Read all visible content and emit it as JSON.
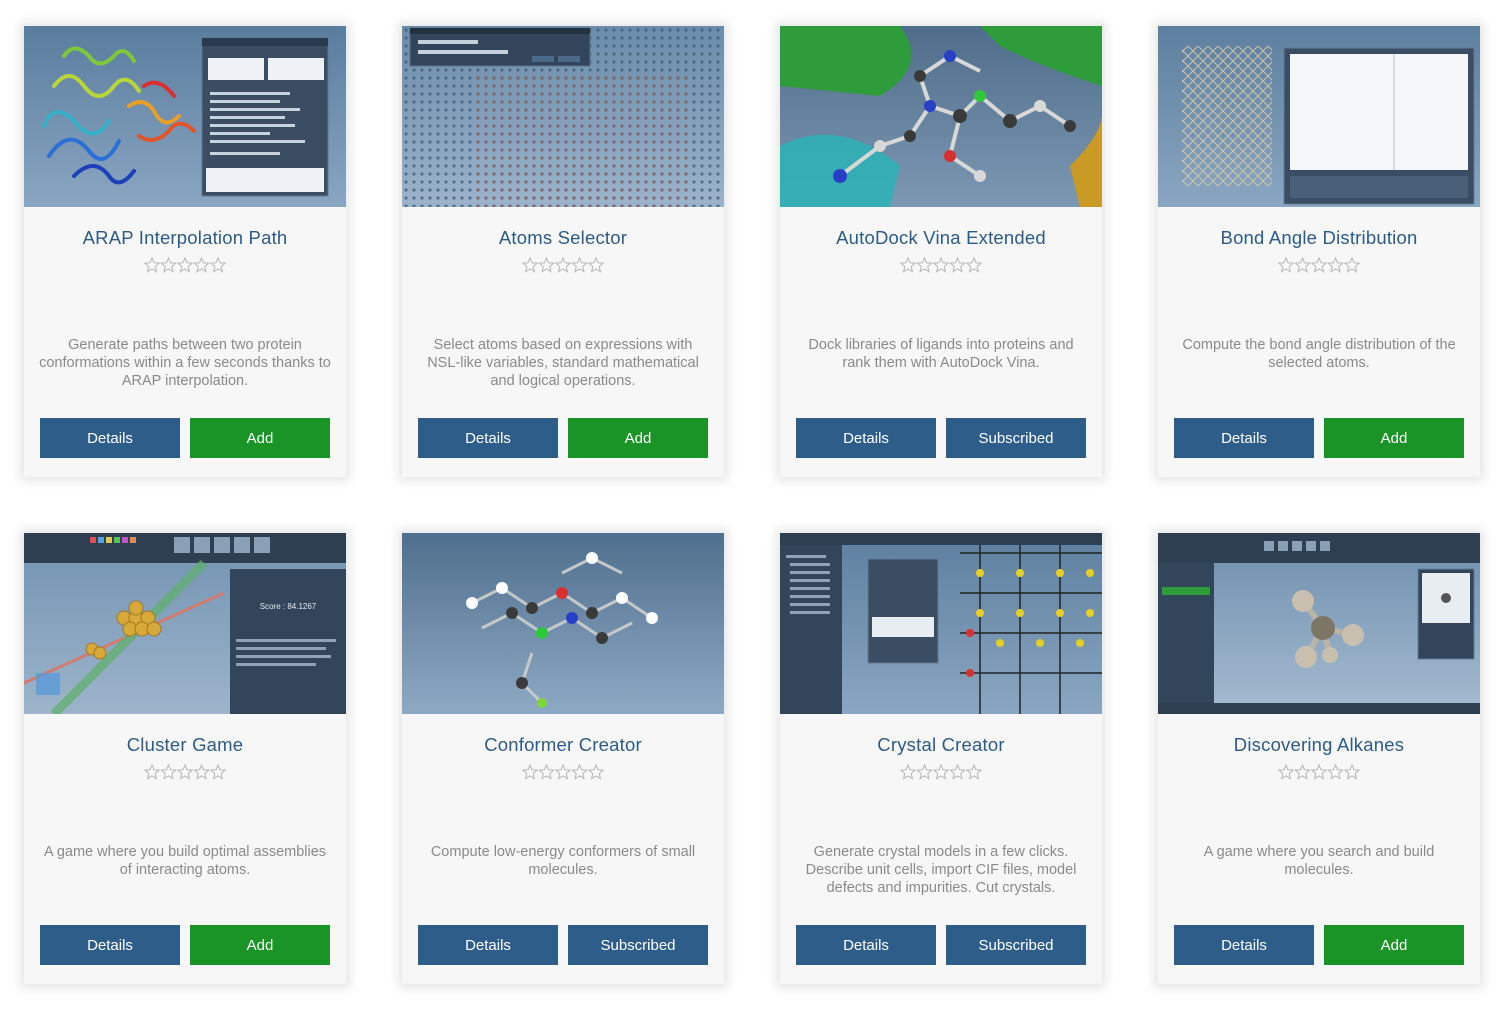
{
  "colors": {
    "title": "#2e5b86",
    "description": "#8a8a8a",
    "details_button": "#2f5d89",
    "add_button": "#1a9426",
    "subscribed_button": "#2f5d89",
    "card_background": "#f7f7f7"
  },
  "rating_max": 5,
  "cards": [
    {
      "title": "ARAP Interpolation Path",
      "rating": 0,
      "description": "Generate paths between two protein conformations within a few seconds thanks to ARAP interpolation.",
      "details_label": "Details",
      "action_label": "Add",
      "action_state": "add",
      "thumbnail": "protein-ribbon-with-dialog"
    },
    {
      "title": "Atoms Selector",
      "rating": 0,
      "description": "Select atoms based on expressions with NSL-like variables, standard mathematical and logical operations.",
      "details_label": "Details",
      "action_label": "Add",
      "action_state": "add",
      "thumbnail": "atom-lattice-with-dialog"
    },
    {
      "title": "AutoDock Vina Extended",
      "rating": 0,
      "description": "Dock libraries of ligands into proteins and rank them with AutoDock Vina.",
      "details_label": "Details",
      "action_label": "Subscribed",
      "action_state": "subscribed",
      "thumbnail": "ligand-in-protein"
    },
    {
      "title": "Bond Angle Distribution",
      "rating": 0,
      "description": "Compute the bond angle distribution of the selected atoms.",
      "details_label": "Details",
      "action_label": "Add",
      "action_state": "add",
      "thumbnail": "crystal-with-plot-window"
    },
    {
      "title": "Cluster Game",
      "rating": 0,
      "description": "A game where you build optimal assemblies of interacting atoms.",
      "details_label": "Details",
      "action_label": "Add",
      "action_state": "add",
      "thumbnail": "cluster-game-screen",
      "thumb_text": "Score : 84.1267"
    },
    {
      "title": "Conformer Creator",
      "rating": 0,
      "description": "Compute low-energy conformers of small molecules.",
      "details_label": "Details",
      "action_label": "Subscribed",
      "action_state": "subscribed",
      "thumbnail": "molecule-conformers"
    },
    {
      "title": "Crystal Creator",
      "rating": 0,
      "description": "Generate crystal models in a few clicks. Describe unit cells, import CIF files, model defects and impurities. Cut crystals.",
      "details_label": "Details",
      "action_label": "Subscribed",
      "action_state": "subscribed",
      "thumbnail": "crystal-creator-screen"
    },
    {
      "title": "Discovering Alkanes",
      "rating": 0,
      "description": "A game where you search and build molecules.",
      "details_label": "Details",
      "action_label": "Add",
      "action_state": "add",
      "thumbnail": "alkane-game-screen"
    }
  ]
}
